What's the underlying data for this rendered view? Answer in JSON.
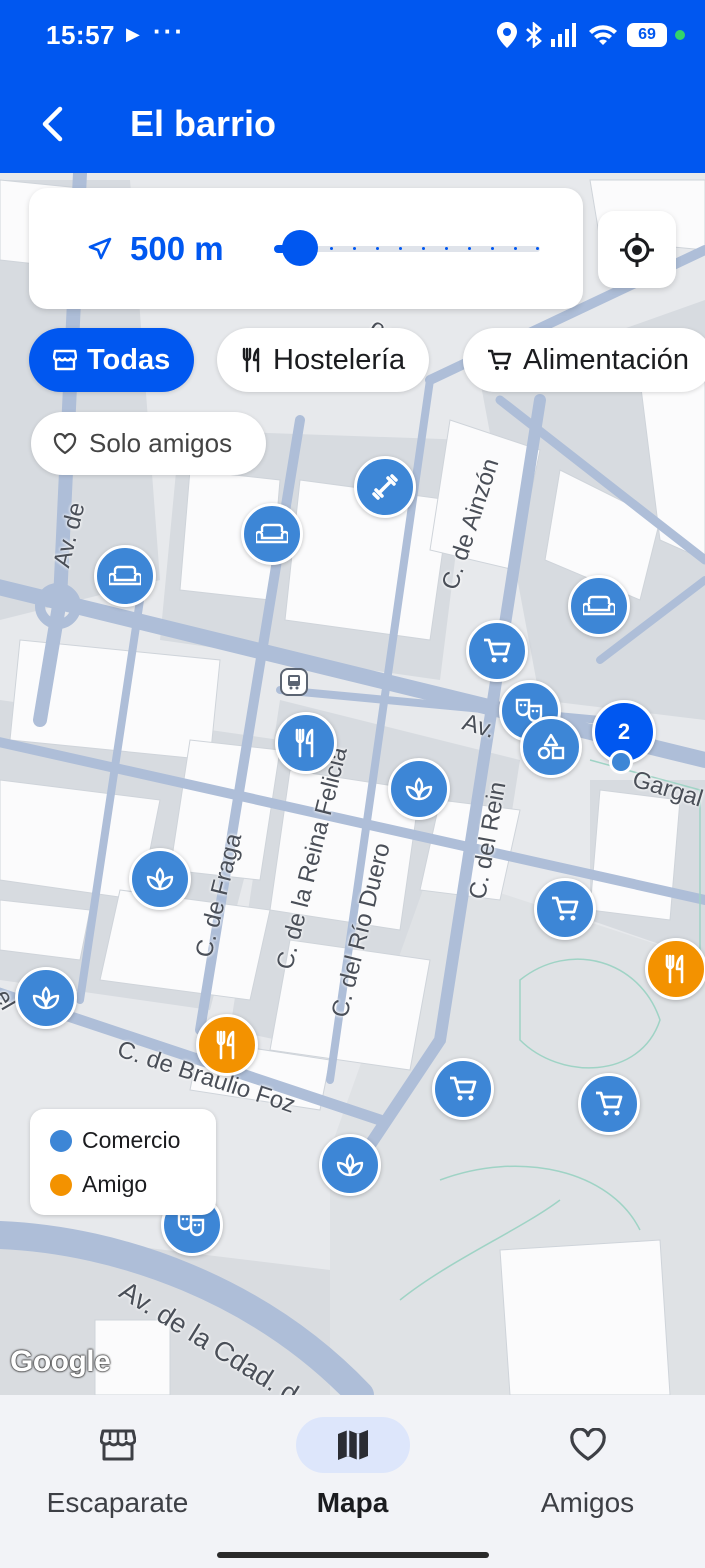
{
  "status_bar": {
    "time": "15:57",
    "battery": "69"
  },
  "app_bar": {
    "title": "El barrio"
  },
  "distance": {
    "value": "500 m",
    "slider_fraction": 0.0
  },
  "filters": {
    "chips": [
      {
        "label": "Todas",
        "active": true
      },
      {
        "label": "Hostelería",
        "active": false
      },
      {
        "label": "Alimentación",
        "active": false
      }
    ],
    "friends_only": "Solo amigos"
  },
  "map": {
    "streets": [
      "Av. de",
      "C. de Ainzón",
      "Av.",
      "Gargal",
      "C. de la Reina Felicia",
      "C. del Río Duero",
      "C. del Rein",
      "C. de Fraga",
      "C. de Braulio Foz",
      "Av. de la Cdad. d",
      "ozara",
      "el"
    ],
    "cluster_count": "2",
    "attribution": "Google"
  },
  "legend": {
    "items": [
      {
        "label": "Comercio",
        "color": "#3d86d6"
      },
      {
        "label": "Amigo",
        "color": "#f39200"
      }
    ]
  },
  "bottom_nav": {
    "items": [
      {
        "label": "Escaparate",
        "icon": "storefront-icon",
        "active": false
      },
      {
        "label": "Mapa",
        "icon": "map-icon",
        "active": true
      },
      {
        "label": "Amigos",
        "icon": "heart-icon",
        "active": false
      }
    ]
  },
  "colors": {
    "primary": "#0057f0",
    "commerce": "#3d86d6",
    "friend": "#f39200"
  }
}
